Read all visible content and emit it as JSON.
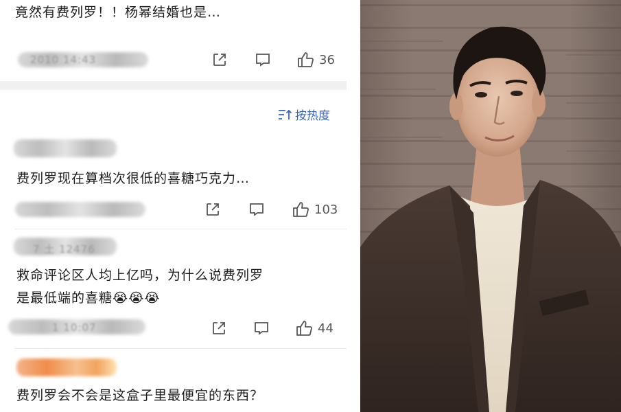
{
  "comments": [
    {
      "text_lines": [
        "竟然有费列罗！！杨幂结婚也是…"
      ],
      "meta_blurred": "2010 14:43",
      "likes": "36"
    },
    {
      "text_lines": [
        "费列罗现在算档次很低的喜糖巧克力…"
      ],
      "likes": "103"
    },
    {
      "text_lines": [
        "救命评论区人均上亿吗，为什么说费列罗",
        "是最低端的喜糖😭😭😭"
      ],
      "name_blurred": "7 土 12476",
      "meta_blurred": "1 10:07",
      "likes": "44"
    },
    {
      "text_lines": [
        "费列罗会不会是这盒子里最便宜的东西？"
      ]
    }
  ],
  "sort": {
    "label": "按热度",
    "icon": "sort-icon"
  },
  "icons": {
    "share": "share-icon",
    "reply": "comment-icon",
    "like": "thumbs-up-icon"
  },
  "colors": {
    "link_blue": "#3a66b3",
    "text": "#1e1e1e",
    "icon_gray": "#555555",
    "divider": "#f0f0f0"
  }
}
